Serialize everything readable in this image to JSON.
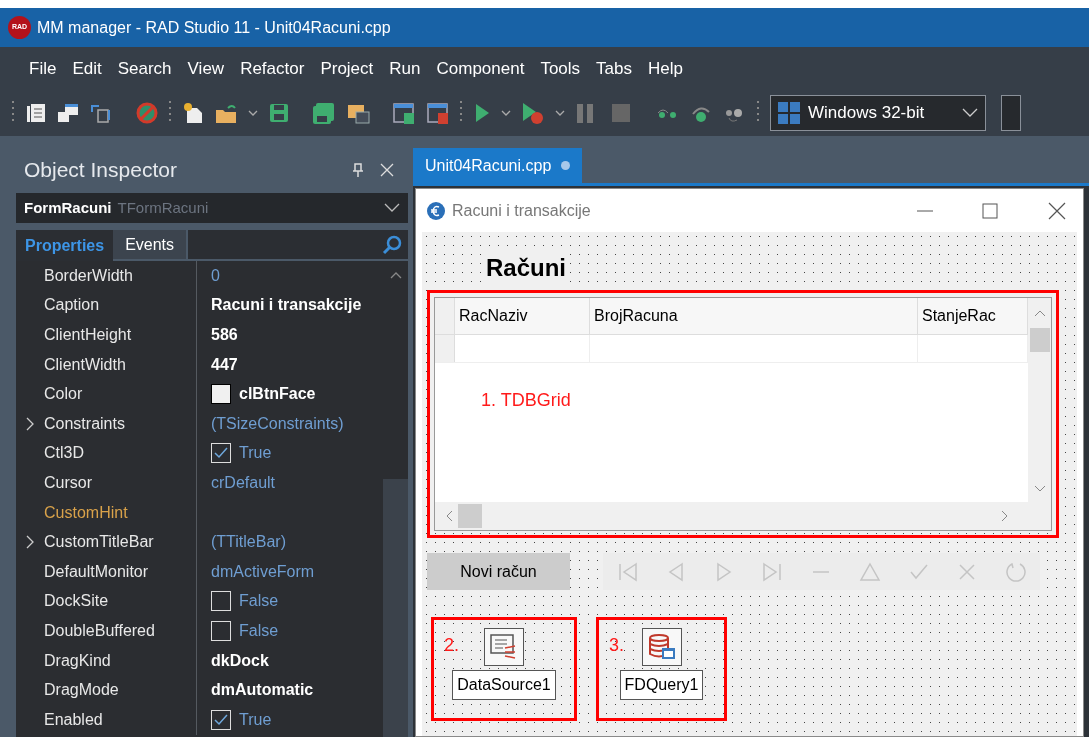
{
  "window": {
    "app_logo": "RAD",
    "title": "MM manager - RAD Studio 11 - Unit04Racuni.cpp"
  },
  "menu": [
    "File",
    "Edit",
    "Search",
    "View",
    "Refactor",
    "Project",
    "Run",
    "Component",
    "Tools",
    "Tabs",
    "Help"
  ],
  "toolbar": {
    "platform": "Windows 32-bit"
  },
  "object_inspector": {
    "title": "Object Inspector",
    "component_name": "FormRacuni",
    "component_type": "TFormRacuni",
    "tabs": [
      {
        "label": "Properties",
        "selected": true
      },
      {
        "label": "Events",
        "selected": false
      }
    ],
    "properties": [
      {
        "name": "BorderWidth",
        "kind": "text",
        "value": "0",
        "modified": false,
        "expandable": false,
        "highlighted": false
      },
      {
        "name": "Caption",
        "kind": "text",
        "value": "Racuni i transakcije",
        "modified": true,
        "expandable": false,
        "highlighted": false
      },
      {
        "name": "ClientHeight",
        "kind": "text",
        "value": "586",
        "modified": true,
        "expandable": false,
        "highlighted": false
      },
      {
        "name": "ClientWidth",
        "kind": "text",
        "value": "447",
        "modified": true,
        "expandable": false,
        "highlighted": false
      },
      {
        "name": "Color",
        "kind": "color",
        "value": "clBtnFace",
        "color": "#f0f0f0",
        "modified": true,
        "expandable": false,
        "highlighted": false
      },
      {
        "name": "Constraints",
        "kind": "text",
        "value": "(TSizeConstraints)",
        "modified": false,
        "expandable": true,
        "highlighted": false
      },
      {
        "name": "Ctl3D",
        "kind": "checkbox",
        "value": "True",
        "checked": true,
        "modified": false,
        "expandable": false,
        "highlighted": false
      },
      {
        "name": "Cursor",
        "kind": "text",
        "value": "crDefault",
        "modified": false,
        "expandable": false,
        "highlighted": false
      },
      {
        "name": "CustomHint",
        "kind": "empty",
        "expandable": false,
        "highlighted": true
      },
      {
        "name": "CustomTitleBar",
        "kind": "text",
        "value": "(TTitleBar)",
        "modified": false,
        "expandable": true,
        "highlighted": false
      },
      {
        "name": "DefaultMonitor",
        "kind": "text",
        "value": "dmActiveForm",
        "modified": false,
        "expandable": false,
        "highlighted": false
      },
      {
        "name": "DockSite",
        "kind": "checkbox",
        "value": "False",
        "checked": false,
        "modified": false,
        "expandable": false,
        "highlighted": false
      },
      {
        "name": "DoubleBuffered",
        "kind": "checkbox",
        "value": "False",
        "checked": false,
        "modified": false,
        "expandable": false,
        "highlighted": false
      },
      {
        "name": "DragKind",
        "kind": "text",
        "value": "dkDock",
        "modified": true,
        "expandable": false,
        "highlighted": false
      },
      {
        "name": "DragMode",
        "kind": "text",
        "value": "dmAutomatic",
        "modified": true,
        "expandable": false,
        "highlighted": false
      },
      {
        "name": "Enabled",
        "kind": "checkbox",
        "value": "True",
        "checked": true,
        "modified": false,
        "expandable": false,
        "highlighted": false
      }
    ]
  },
  "editor": {
    "tab": {
      "label": "Unit04Racuni.cpp",
      "modified": true
    },
    "form": {
      "title": "Racuni i transakcije",
      "heading": "Računi",
      "grid": {
        "columns": [
          "RacNaziv",
          "BrojRacuna",
          "StanjeRac"
        ],
        "annotation": "1. TDBGrid"
      },
      "button": "Novi račun",
      "navigator": {
        "disabled": true
      },
      "components": [
        {
          "number": "2.",
          "name": "DataSource1",
          "kind": "datasource"
        },
        {
          "number": "3.",
          "name": "FDQuery1",
          "kind": "query"
        }
      ]
    }
  }
}
